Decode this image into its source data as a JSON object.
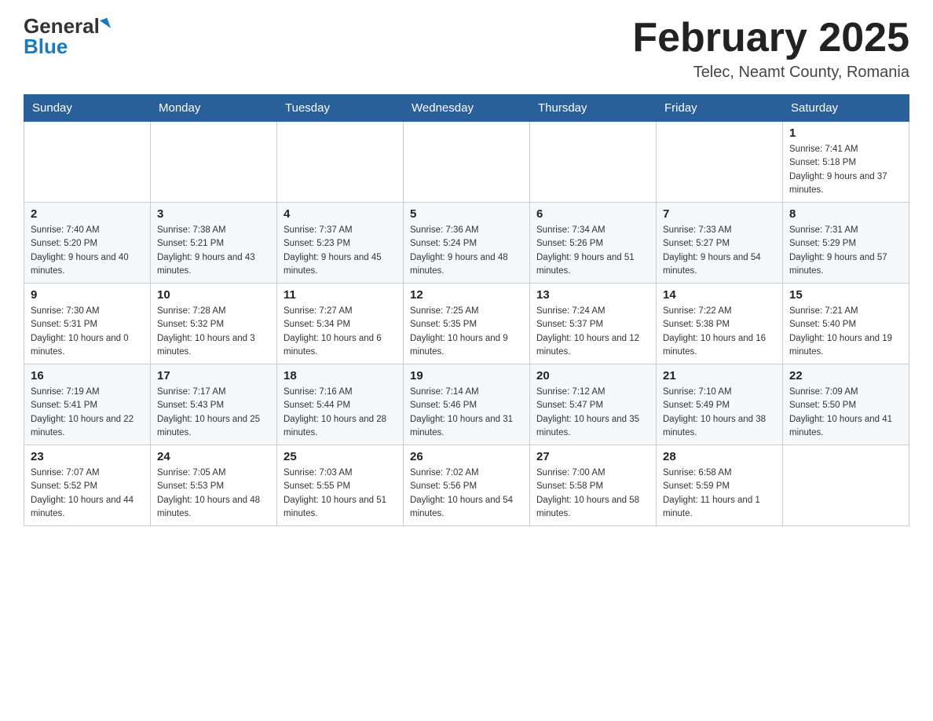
{
  "header": {
    "logo_general": "General",
    "logo_blue": "Blue",
    "month_title": "February 2025",
    "location": "Telec, Neamt County, Romania"
  },
  "weekdays": [
    "Sunday",
    "Monday",
    "Tuesday",
    "Wednesday",
    "Thursday",
    "Friday",
    "Saturday"
  ],
  "weeks": [
    [
      {
        "day": "",
        "info": ""
      },
      {
        "day": "",
        "info": ""
      },
      {
        "day": "",
        "info": ""
      },
      {
        "day": "",
        "info": ""
      },
      {
        "day": "",
        "info": ""
      },
      {
        "day": "",
        "info": ""
      },
      {
        "day": "1",
        "info": "Sunrise: 7:41 AM\nSunset: 5:18 PM\nDaylight: 9 hours and 37 minutes."
      }
    ],
    [
      {
        "day": "2",
        "info": "Sunrise: 7:40 AM\nSunset: 5:20 PM\nDaylight: 9 hours and 40 minutes."
      },
      {
        "day": "3",
        "info": "Sunrise: 7:38 AM\nSunset: 5:21 PM\nDaylight: 9 hours and 43 minutes."
      },
      {
        "day": "4",
        "info": "Sunrise: 7:37 AM\nSunset: 5:23 PM\nDaylight: 9 hours and 45 minutes."
      },
      {
        "day": "5",
        "info": "Sunrise: 7:36 AM\nSunset: 5:24 PM\nDaylight: 9 hours and 48 minutes."
      },
      {
        "day": "6",
        "info": "Sunrise: 7:34 AM\nSunset: 5:26 PM\nDaylight: 9 hours and 51 minutes."
      },
      {
        "day": "7",
        "info": "Sunrise: 7:33 AM\nSunset: 5:27 PM\nDaylight: 9 hours and 54 minutes."
      },
      {
        "day": "8",
        "info": "Sunrise: 7:31 AM\nSunset: 5:29 PM\nDaylight: 9 hours and 57 minutes."
      }
    ],
    [
      {
        "day": "9",
        "info": "Sunrise: 7:30 AM\nSunset: 5:31 PM\nDaylight: 10 hours and 0 minutes."
      },
      {
        "day": "10",
        "info": "Sunrise: 7:28 AM\nSunset: 5:32 PM\nDaylight: 10 hours and 3 minutes."
      },
      {
        "day": "11",
        "info": "Sunrise: 7:27 AM\nSunset: 5:34 PM\nDaylight: 10 hours and 6 minutes."
      },
      {
        "day": "12",
        "info": "Sunrise: 7:25 AM\nSunset: 5:35 PM\nDaylight: 10 hours and 9 minutes."
      },
      {
        "day": "13",
        "info": "Sunrise: 7:24 AM\nSunset: 5:37 PM\nDaylight: 10 hours and 12 minutes."
      },
      {
        "day": "14",
        "info": "Sunrise: 7:22 AM\nSunset: 5:38 PM\nDaylight: 10 hours and 16 minutes."
      },
      {
        "day": "15",
        "info": "Sunrise: 7:21 AM\nSunset: 5:40 PM\nDaylight: 10 hours and 19 minutes."
      }
    ],
    [
      {
        "day": "16",
        "info": "Sunrise: 7:19 AM\nSunset: 5:41 PM\nDaylight: 10 hours and 22 minutes."
      },
      {
        "day": "17",
        "info": "Sunrise: 7:17 AM\nSunset: 5:43 PM\nDaylight: 10 hours and 25 minutes."
      },
      {
        "day": "18",
        "info": "Sunrise: 7:16 AM\nSunset: 5:44 PM\nDaylight: 10 hours and 28 minutes."
      },
      {
        "day": "19",
        "info": "Sunrise: 7:14 AM\nSunset: 5:46 PM\nDaylight: 10 hours and 31 minutes."
      },
      {
        "day": "20",
        "info": "Sunrise: 7:12 AM\nSunset: 5:47 PM\nDaylight: 10 hours and 35 minutes."
      },
      {
        "day": "21",
        "info": "Sunrise: 7:10 AM\nSunset: 5:49 PM\nDaylight: 10 hours and 38 minutes."
      },
      {
        "day": "22",
        "info": "Sunrise: 7:09 AM\nSunset: 5:50 PM\nDaylight: 10 hours and 41 minutes."
      }
    ],
    [
      {
        "day": "23",
        "info": "Sunrise: 7:07 AM\nSunset: 5:52 PM\nDaylight: 10 hours and 44 minutes."
      },
      {
        "day": "24",
        "info": "Sunrise: 7:05 AM\nSunset: 5:53 PM\nDaylight: 10 hours and 48 minutes."
      },
      {
        "day": "25",
        "info": "Sunrise: 7:03 AM\nSunset: 5:55 PM\nDaylight: 10 hours and 51 minutes."
      },
      {
        "day": "26",
        "info": "Sunrise: 7:02 AM\nSunset: 5:56 PM\nDaylight: 10 hours and 54 minutes."
      },
      {
        "day": "27",
        "info": "Sunrise: 7:00 AM\nSunset: 5:58 PM\nDaylight: 10 hours and 58 minutes."
      },
      {
        "day": "28",
        "info": "Sunrise: 6:58 AM\nSunset: 5:59 PM\nDaylight: 11 hours and 1 minute."
      },
      {
        "day": "",
        "info": ""
      }
    ]
  ]
}
